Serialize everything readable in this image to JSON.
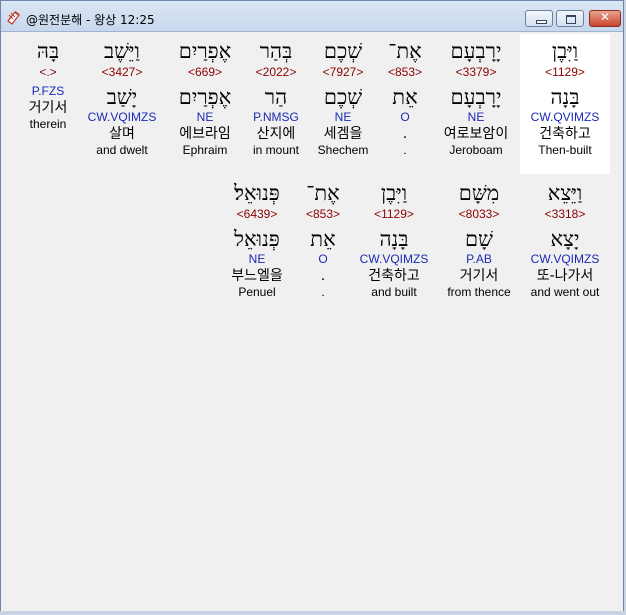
{
  "window": {
    "title": "@원전분해 - 왕상 12:25",
    "icon": "app-icon"
  },
  "row1": [
    {
      "heb": "וַיִּבֶן",
      "num": "<1129>",
      "lemma": "בָּנָה",
      "parse": "CW.QVIMZS",
      "kor": "건축하고",
      "eng": "Then-built"
    },
    {
      "heb": "יָרָבְעָם",
      "num": "<3379>",
      "lemma": "יָרָבְעָם",
      "parse": "NE",
      "kor": "여로보암이",
      "eng": "Jeroboam"
    },
    {
      "heb": "אֶת־",
      "num": "<853>",
      "lemma": "אֵת",
      "parse": "O",
      "kor": ".",
      "eng": "."
    },
    {
      "heb": "שְׁכֶם",
      "num": "<7927>",
      "lemma": "שְׁכֶם",
      "parse": "NE",
      "kor": "세겜을",
      "eng": "Shechem"
    },
    {
      "heb": "בְּהַר",
      "num": "<2022>",
      "lemma": "הַר",
      "parse": "P.NMSG",
      "kor": "산지에",
      "eng": "in mount"
    },
    {
      "heb": "אֶפְרַיִם",
      "num": "<669>",
      "lemma": "אֶפְרַיִם",
      "parse": "NE",
      "kor": "에브라임",
      "eng": "Ephraim"
    },
    {
      "heb": "וַיֵּשֶׁב",
      "num": "<3427>",
      "lemma": "יָשַׁב",
      "parse": "CW.VQIMZS",
      "kor": "살며",
      "eng": "and dwelt"
    },
    {
      "heb": "בָּהּ",
      "num": "<.>",
      "lemma": "",
      "parse": "P.FZS",
      "kor": "거기서",
      "eng": "therein"
    }
  ],
  "row2": [
    {
      "heb": "וַיֵּצֵא",
      "num": "<3318>",
      "lemma": "יָצָא",
      "parse": "CW.VQIMZS",
      "kor": "또-나가서",
      "eng": "and went out"
    },
    {
      "heb": "מִשָּׁם",
      "num": "<8033>",
      "lemma": "שָׁם",
      "parse": "P.AB",
      "kor": "거기서",
      "eng": "from thence"
    },
    {
      "heb": "וַיִּבֶן",
      "num": "<1129>",
      "lemma": "בָּנָה",
      "parse": "CW.VQIMZS",
      "kor": "건축하고",
      "eng": "and built"
    },
    {
      "heb": "אֶת־",
      "num": "<853>",
      "lemma": "אֵת",
      "parse": "O",
      "kor": ".",
      "eng": "."
    },
    {
      "heb": "פְּנוּאֵל׃",
      "num": "<6439>",
      "lemma": "פְּנוּאֵל",
      "parse": "NE",
      "kor": "부느엘을",
      "eng": "Penuel"
    }
  ]
}
